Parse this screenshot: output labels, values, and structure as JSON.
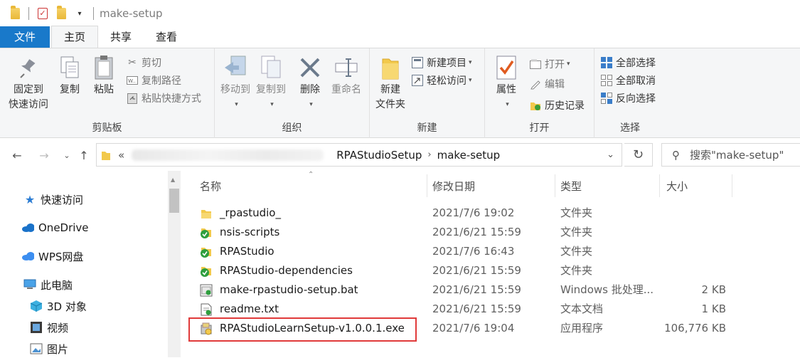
{
  "titlebar": {
    "title": "make-setup"
  },
  "tabs": [
    {
      "label": "文件",
      "type": "file"
    },
    {
      "label": "主页",
      "type": "active"
    },
    {
      "label": "共享",
      "type": ""
    },
    {
      "label": "查看",
      "type": ""
    }
  ],
  "ribbon": {
    "clipboard": {
      "label": "剪贴板",
      "pin_line1": "固定到",
      "pin_line2": "快速访问",
      "copy": "复制",
      "paste": "粘贴",
      "cut": "剪切",
      "copy_path": "复制路径",
      "paste_shortcut": "粘贴快捷方式"
    },
    "organize": {
      "label": "组织",
      "move_to": "移动到",
      "copy_to": "复制到",
      "delete": "删除",
      "rename": "重命名"
    },
    "new": {
      "label": "新建",
      "new_folder_line1": "新建",
      "new_folder_line2": "文件夹",
      "new_item": "新建项目",
      "easy_access": "轻松访问"
    },
    "open": {
      "label": "打开",
      "properties": "属性",
      "open": "打开",
      "edit": "编辑",
      "history": "历史记录"
    },
    "select": {
      "label": "选择",
      "select_all": "全部选择",
      "select_none": "全部取消",
      "invert": "反向选择"
    }
  },
  "address": {
    "prefix": "«",
    "crumbs": [
      "RPAStudioSetup",
      "make-setup"
    ],
    "search_placeholder": "搜索\"make-setup\""
  },
  "navpane": {
    "items": [
      {
        "label": "快速访问",
        "icon": "star-icon"
      },
      {
        "label": "OneDrive",
        "icon": "cloud-icon"
      },
      {
        "label": "WPS网盘",
        "icon": "wps-cloud-icon"
      },
      {
        "label": "此电脑",
        "icon": "computer-icon"
      },
      {
        "label": "3D 对象",
        "icon": "cube-icon"
      },
      {
        "label": "视频",
        "icon": "video-icon"
      },
      {
        "label": "图片",
        "icon": "picture-icon"
      }
    ]
  },
  "files": {
    "columns": {
      "name": "名称",
      "date": "修改日期",
      "type": "类型",
      "size": "大小"
    },
    "rows": [
      {
        "name": "_rpastudio_",
        "date": "2021/7/6 19:02",
        "type": "文件夹",
        "size": "",
        "icon": "folder-icon"
      },
      {
        "name": "nsis-scripts",
        "date": "2021/6/21 15:59",
        "type": "文件夹",
        "size": "",
        "icon": "folder-synced-icon"
      },
      {
        "name": "RPAStudio",
        "date": "2021/7/6 16:43",
        "type": "文件夹",
        "size": "",
        "icon": "folder-synced-icon"
      },
      {
        "name": "RPAStudio-dependencies",
        "date": "2021/6/21 15:59",
        "type": "文件夹",
        "size": "",
        "icon": "folder-synced-icon"
      },
      {
        "name": "make-rpastudio-setup.bat",
        "date": "2021/6/21 15:59",
        "type": "Windows 批处理...",
        "size": "2 KB",
        "icon": "batch-file-icon"
      },
      {
        "name": "readme.txt",
        "date": "2021/6/21 15:59",
        "type": "文本文档",
        "size": "1 KB",
        "icon": "text-file-icon"
      },
      {
        "name": "RPAStudioLearnSetup-v1.0.0.1.exe",
        "date": "2021/7/6 19:04",
        "type": "应用程序",
        "size": "106,776 KB",
        "icon": "installer-exe-icon"
      }
    ]
  },
  "colors": {
    "file_tab": "#1979ca",
    "highlight": "#e03a3a",
    "folder": "#f2c94c",
    "sync_green": "#2e9e3e"
  }
}
